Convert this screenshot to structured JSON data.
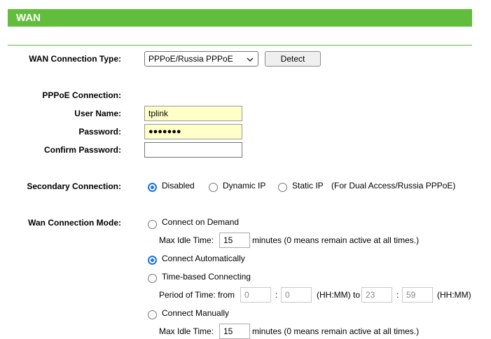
{
  "header": {
    "title": "WAN"
  },
  "wan_type": {
    "label": "WAN Connection Type:",
    "selected": "PPPoE/Russia PPPoE",
    "detect_label": "Detect"
  },
  "pppoe": {
    "section_label": "PPPoE Connection:",
    "username_label": "User Name:",
    "username_value": "tplink",
    "password_label": "Password:",
    "password_value": "●●●●●●●",
    "confirm_label": "Confirm Password:",
    "confirm_value": ""
  },
  "secondary": {
    "label": "Secondary Connection:",
    "options": [
      "Disabled",
      "Dynamic IP",
      "Static IP"
    ],
    "selected": "Disabled",
    "note": "(For Dual Access/Russia PPPoE)"
  },
  "mode": {
    "label": "Wan Connection Mode:",
    "on_demand_label": "Connect on Demand",
    "idle_label": "Max Idle Time:",
    "idle_value": "15",
    "idle_suffix": "minutes (0 means remain active at all times.)",
    "auto_label": "Connect Automatically",
    "time_based_label": "Time-based Connecting",
    "period_label": "Period of Time: from",
    "from_hh": "0",
    "from_mm": "0",
    "colon": ":",
    "hhmm_to": "(HH:MM) to",
    "to_hh": "23",
    "to_mm": "59",
    "hhmm": "(HH:MM)",
    "manual_label": "Connect Manually",
    "manual_idle_label": "Max Idle Time:",
    "manual_idle_value": "15",
    "manual_idle_suffix": "minutes (0 means remain active at all times.)",
    "selected": "Connect Automatically"
  },
  "colors": {
    "accent_green": "#62bd3d",
    "radio_blue": "#1a73e8",
    "highlight_yellow": "#ffffc8"
  }
}
